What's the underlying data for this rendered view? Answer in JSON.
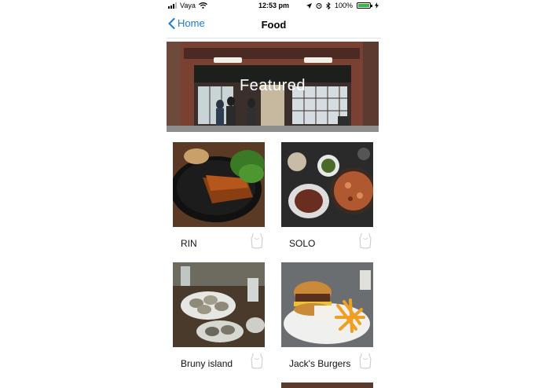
{
  "status_bar": {
    "carrier": "Vaya",
    "time": "12:53 pm",
    "battery": "100%"
  },
  "nav": {
    "back_label": "Home",
    "title": "Food"
  },
  "featured": {
    "label": "Featured"
  },
  "restaurants": [
    {
      "name": "RIN"
    },
    {
      "name": "SOLO"
    },
    {
      "name": "Bruny island"
    },
    {
      "name": "Jack's Burgers"
    }
  ],
  "colors": {
    "accent": "#1a7bd6",
    "battery": "#27c23a"
  }
}
